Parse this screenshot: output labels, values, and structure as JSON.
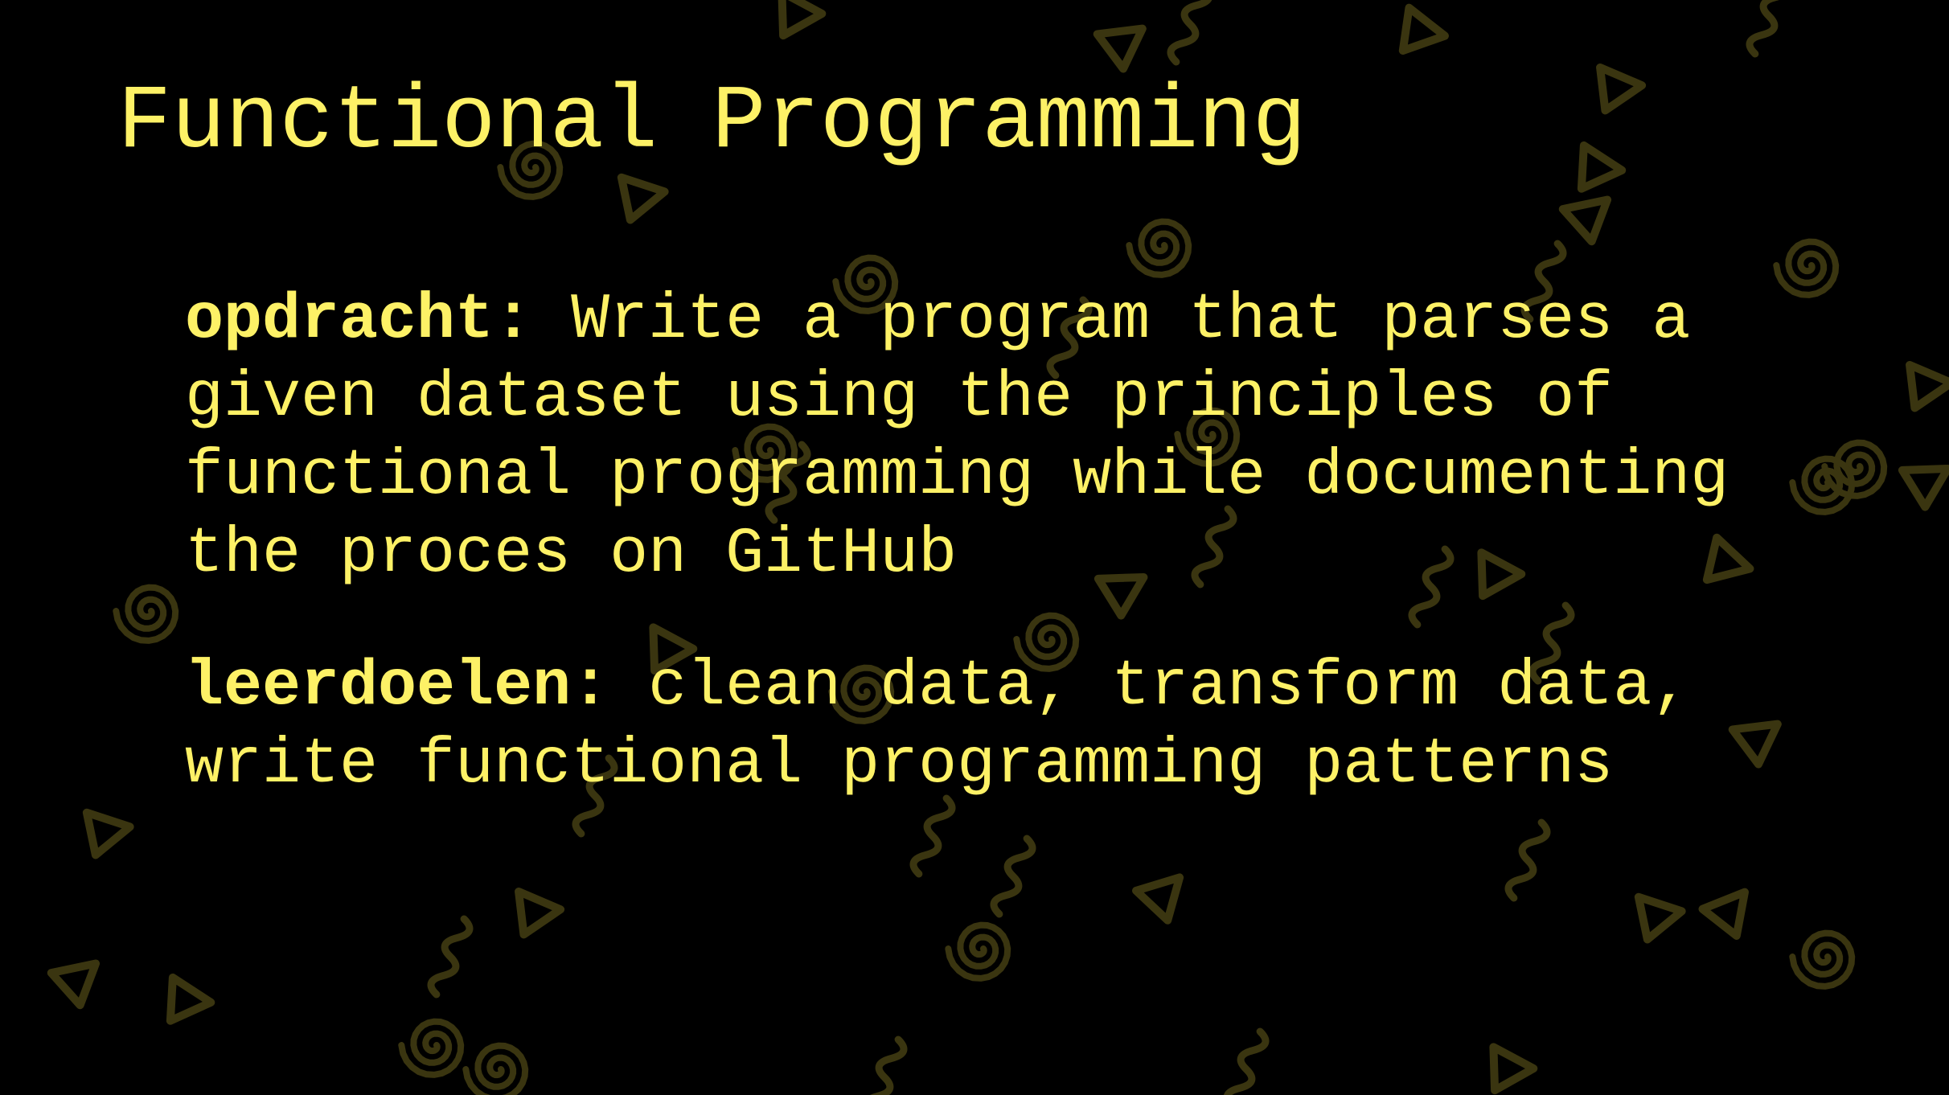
{
  "slide": {
    "title": "Functional Programming",
    "colors": {
      "background": "#000000",
      "text": "#fdf166",
      "pattern": "#3a3510"
    },
    "decoration_icons": [
      "triangle-icon",
      "spiral-icon",
      "squiggle-icon"
    ],
    "opdracht": {
      "term": "opdracht",
      "lines": [
        "Write a program that parses a",
        "given dataset using the principles of",
        "functional programming while documenting",
        "the proces on GitHub"
      ]
    },
    "leerdoelen": {
      "term": "leerdoelen",
      "lines": [
        "clean data, transform data,",
        "write functional programming patterns"
      ]
    }
  }
}
